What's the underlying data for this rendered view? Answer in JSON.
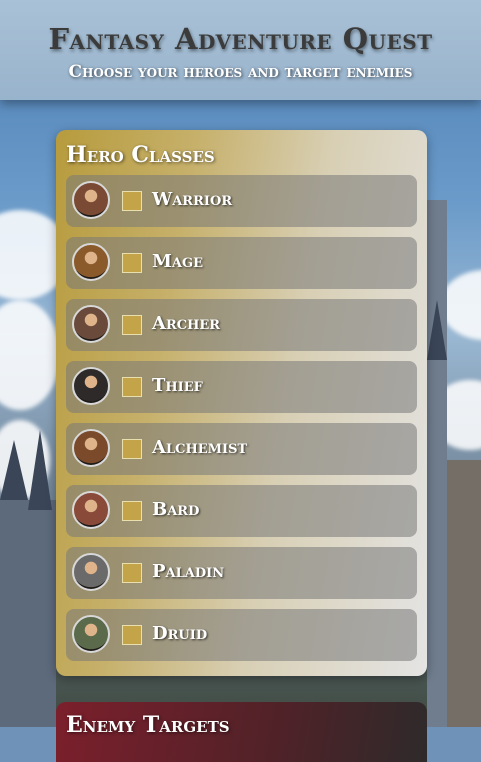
{
  "header": {
    "title": "Fantasy Adventure Quest",
    "subtitle": "Choose your heroes and target enemies"
  },
  "hero_panel": {
    "title": "Hero Classes",
    "heroes": [
      {
        "label": "Warrior",
        "checked": false,
        "portrait_color": "#7a4a34"
      },
      {
        "label": "Mage",
        "checked": false,
        "portrait_color": "#8a5a2a"
      },
      {
        "label": "Archer",
        "checked": false,
        "portrait_color": "#6a4a3a"
      },
      {
        "label": "Thief",
        "checked": false,
        "portrait_color": "#2e2a2a"
      },
      {
        "label": "Alchemist",
        "checked": false,
        "portrait_color": "#7a4a2a"
      },
      {
        "label": "Bard",
        "checked": false,
        "portrait_color": "#8a4a3a"
      },
      {
        "label": "Paladin",
        "checked": false,
        "portrait_color": "#6a6a6a"
      },
      {
        "label": "Druid",
        "checked": false,
        "portrait_color": "#5a6a4a"
      }
    ]
  },
  "enemy_panel": {
    "title": "Enemy Targets"
  },
  "colors": {
    "header_bg": "#a9c1d6",
    "checkbox": "#c4a448",
    "hero_panel_gold": "#b79b3d",
    "enemy_panel_red": "#7c1f2c"
  }
}
